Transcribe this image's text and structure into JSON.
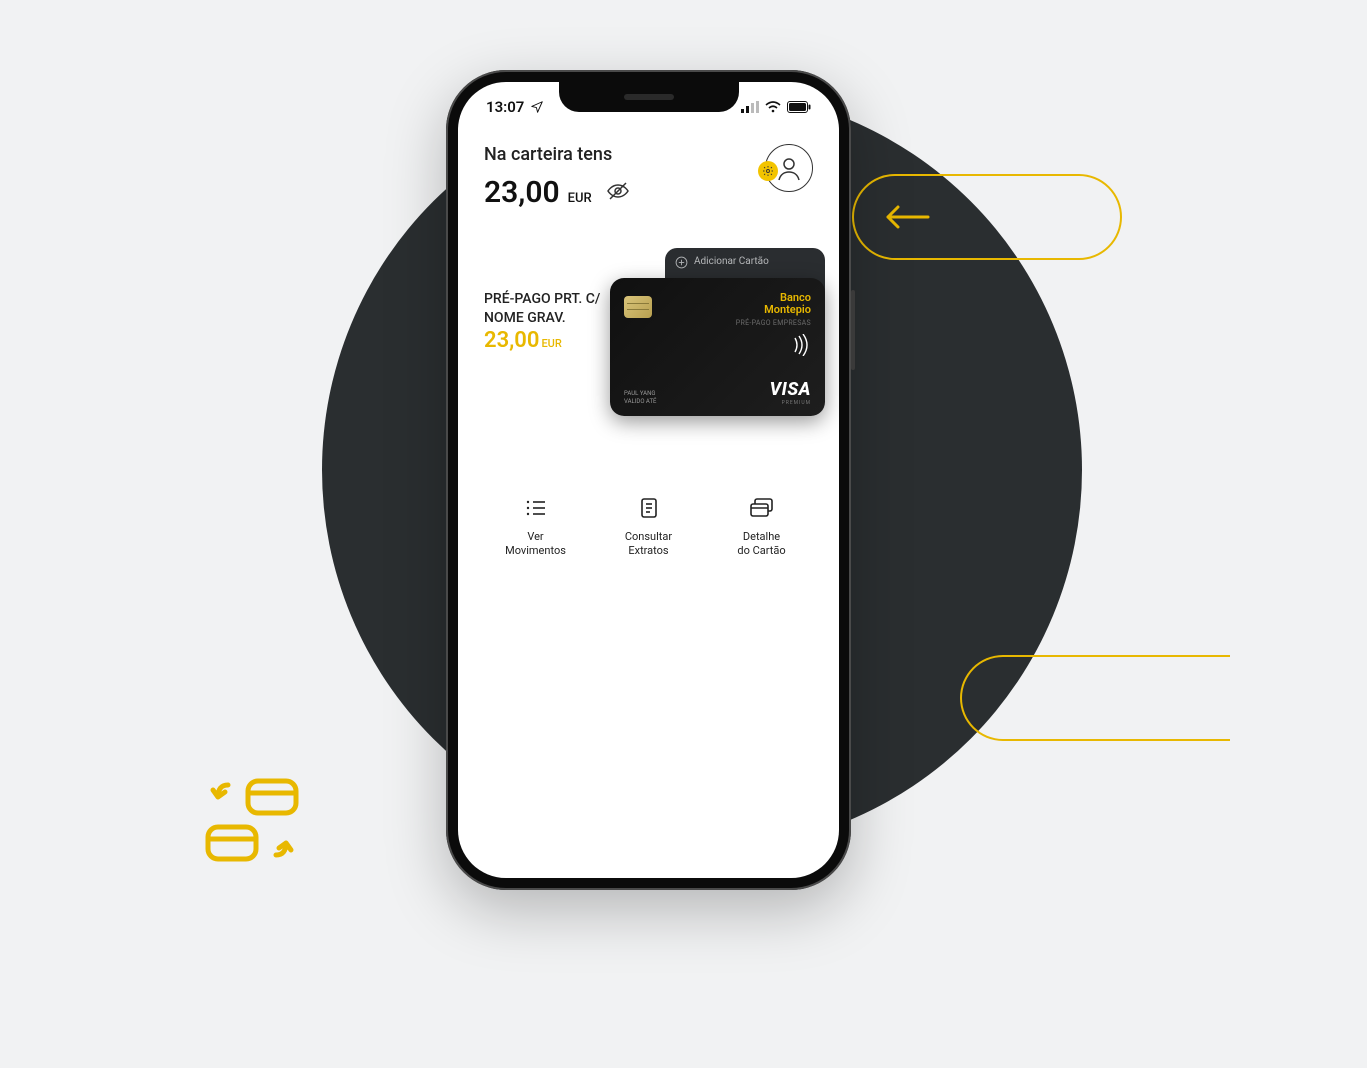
{
  "status": {
    "time": "13:07"
  },
  "wallet": {
    "label": "Na carteira tens",
    "amount": "23,00",
    "currency": "EUR"
  },
  "add_card_label": "Adicionar Cartão",
  "card": {
    "name": "PRÉ-PAGO PRT. C/ NOME GRAV.",
    "amount": "23,00",
    "currency": "EUR",
    "brand_line1": "Banco",
    "brand_line2": "Montepio",
    "brand_sub": "PRÉ-PAGO EMPRESAS",
    "network": "VISA",
    "network_sub": "PREMIUM",
    "holder_line1": "PAUL YANG",
    "holder_line2": "VALIDO ATÉ"
  },
  "actions": [
    {
      "icon": "list",
      "label_line1": "Ver",
      "label_line2": "Movimentos"
    },
    {
      "icon": "document",
      "label_line1": "Consultar",
      "label_line2": "Extratos"
    },
    {
      "icon": "cards",
      "label_line1": "Detalhe",
      "label_line2": "do Cartão"
    }
  ]
}
